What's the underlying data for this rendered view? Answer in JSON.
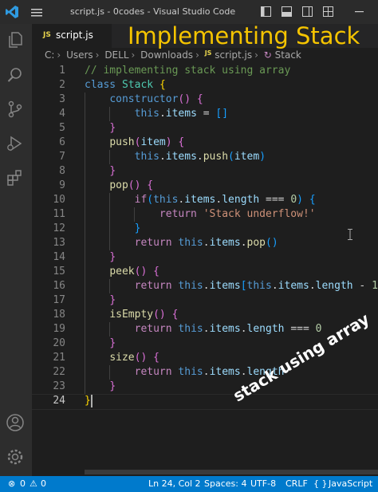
{
  "window": {
    "title": "script.js - 0codes - Visual Studio Code"
  },
  "tab": {
    "badge": "JS",
    "label": "script.js"
  },
  "overlay": {
    "title": "Implementing Stack",
    "caption": "stack using array"
  },
  "breadcrumb": {
    "segments": [
      "C:",
      "Users",
      "DELL",
      "Downloads"
    ],
    "file_badge": "JS",
    "file": "script.js",
    "symbol_icon": "↻",
    "symbol": "Stack"
  },
  "editor": {
    "current_line": 24,
    "lines": [
      {
        "n": "1",
        "tokens": [
          [
            "c",
            "// implementing stack using array"
          ]
        ]
      },
      {
        "n": "2",
        "tokens": [
          [
            "k",
            "class"
          ],
          [
            "o",
            " "
          ],
          [
            "t",
            "Stack"
          ],
          [
            "o",
            " "
          ],
          [
            "b1",
            "{"
          ]
        ]
      },
      {
        "n": "3",
        "tokens": [
          [
            "o",
            "    "
          ],
          [
            "k",
            "constructor"
          ],
          [
            "b2",
            "()"
          ],
          [
            "o",
            " "
          ],
          [
            "b2",
            "{"
          ]
        ]
      },
      {
        "n": "4",
        "tokens": [
          [
            "o",
            "        "
          ],
          [
            "k",
            "this"
          ],
          [
            "o",
            "."
          ],
          [
            "v",
            "items"
          ],
          [
            "o",
            " = "
          ],
          [
            "b3",
            "[]"
          ]
        ]
      },
      {
        "n": "5",
        "tokens": [
          [
            "o",
            "    "
          ],
          [
            "b2",
            "}"
          ]
        ]
      },
      {
        "n": "6",
        "tokens": [
          [
            "o",
            "    "
          ],
          [
            "f",
            "push"
          ],
          [
            "b2",
            "("
          ],
          [
            "v",
            "item"
          ],
          [
            "b2",
            ")"
          ],
          [
            "o",
            " "
          ],
          [
            "b2",
            "{"
          ]
        ]
      },
      {
        "n": "7",
        "tokens": [
          [
            "o",
            "        "
          ],
          [
            "k",
            "this"
          ],
          [
            "o",
            "."
          ],
          [
            "v",
            "items"
          ],
          [
            "o",
            "."
          ],
          [
            "f",
            "push"
          ],
          [
            "b3",
            "("
          ],
          [
            "v",
            "item"
          ],
          [
            "b3",
            ")"
          ]
        ]
      },
      {
        "n": "8",
        "tokens": [
          [
            "o",
            "    "
          ],
          [
            "b2",
            "}"
          ]
        ]
      },
      {
        "n": "9",
        "tokens": [
          [
            "o",
            "    "
          ],
          [
            "f",
            "pop"
          ],
          [
            "b2",
            "()"
          ],
          [
            "o",
            " "
          ],
          [
            "b2",
            "{"
          ]
        ]
      },
      {
        "n": "10",
        "tokens": [
          [
            "o",
            "        "
          ],
          [
            "k2",
            "if"
          ],
          [
            "b3",
            "("
          ],
          [
            "k",
            "this"
          ],
          [
            "o",
            "."
          ],
          [
            "v",
            "items"
          ],
          [
            "o",
            "."
          ],
          [
            "v",
            "length"
          ],
          [
            "o",
            " === "
          ],
          [
            "n",
            "0"
          ],
          [
            "b3",
            ")"
          ],
          [
            "o",
            " "
          ],
          [
            "b3",
            "{"
          ]
        ]
      },
      {
        "n": "11",
        "tokens": [
          [
            "o",
            "            "
          ],
          [
            "k2",
            "return"
          ],
          [
            "o",
            " "
          ],
          [
            "s",
            "'Stack underflow!'"
          ]
        ]
      },
      {
        "n": "12",
        "tokens": [
          [
            "o",
            "        "
          ],
          [
            "b3",
            "}"
          ]
        ]
      },
      {
        "n": "13",
        "tokens": [
          [
            "o",
            "        "
          ],
          [
            "k2",
            "return"
          ],
          [
            "o",
            " "
          ],
          [
            "k",
            "this"
          ],
          [
            "o",
            "."
          ],
          [
            "v",
            "items"
          ],
          [
            "o",
            "."
          ],
          [
            "f",
            "pop"
          ],
          [
            "b3",
            "()"
          ]
        ]
      },
      {
        "n": "14",
        "tokens": [
          [
            "o",
            "    "
          ],
          [
            "b2",
            "}"
          ]
        ]
      },
      {
        "n": "15",
        "tokens": [
          [
            "o",
            "    "
          ],
          [
            "f",
            "peek"
          ],
          [
            "b2",
            "()"
          ],
          [
            "o",
            " "
          ],
          [
            "b2",
            "{"
          ]
        ]
      },
      {
        "n": "16",
        "tokens": [
          [
            "o",
            "        "
          ],
          [
            "k2",
            "return"
          ],
          [
            "o",
            " "
          ],
          [
            "k",
            "this"
          ],
          [
            "o",
            "."
          ],
          [
            "v",
            "items"
          ],
          [
            "b3",
            "["
          ],
          [
            "k",
            "this"
          ],
          [
            "o",
            "."
          ],
          [
            "v",
            "items"
          ],
          [
            "o",
            "."
          ],
          [
            "v",
            "length"
          ],
          [
            "o",
            " - "
          ],
          [
            "n",
            "1"
          ],
          [
            "b3",
            "]"
          ]
        ]
      },
      {
        "n": "17",
        "tokens": [
          [
            "o",
            "    "
          ],
          [
            "b2",
            "}"
          ]
        ]
      },
      {
        "n": "18",
        "tokens": [
          [
            "o",
            "    "
          ],
          [
            "f",
            "isEmpty"
          ],
          [
            "b2",
            "()"
          ],
          [
            "o",
            " "
          ],
          [
            "b2",
            "{"
          ]
        ]
      },
      {
        "n": "19",
        "tokens": [
          [
            "o",
            "        "
          ],
          [
            "k2",
            "return"
          ],
          [
            "o",
            " "
          ],
          [
            "k",
            "this"
          ],
          [
            "o",
            "."
          ],
          [
            "v",
            "items"
          ],
          [
            "o",
            "."
          ],
          [
            "v",
            "length"
          ],
          [
            "o",
            " === "
          ],
          [
            "n",
            "0"
          ]
        ]
      },
      {
        "n": "20",
        "tokens": [
          [
            "o",
            "    "
          ],
          [
            "b2",
            "}"
          ]
        ]
      },
      {
        "n": "21",
        "tokens": [
          [
            "o",
            "    "
          ],
          [
            "f",
            "size"
          ],
          [
            "b2",
            "()"
          ],
          [
            "o",
            " "
          ],
          [
            "b2",
            "{"
          ]
        ]
      },
      {
        "n": "22",
        "tokens": [
          [
            "o",
            "        "
          ],
          [
            "k2",
            "return"
          ],
          [
            "o",
            " "
          ],
          [
            "k",
            "this"
          ],
          [
            "o",
            "."
          ],
          [
            "v",
            "items"
          ],
          [
            "o",
            "."
          ],
          [
            "v",
            "length"
          ]
        ]
      },
      {
        "n": "23",
        "tokens": [
          [
            "o",
            "    "
          ],
          [
            "b2",
            "}"
          ]
        ]
      },
      {
        "n": "24",
        "tokens": [
          [
            "b1",
            "}"
          ]
        ]
      }
    ]
  },
  "statusbar": {
    "errors": "0",
    "warnings": "0",
    "position": "Ln 24, Col 2",
    "spaces": "Spaces: 4",
    "encoding": "UTF-8",
    "eol": "CRLF",
    "language_icon": "{ }",
    "language": "JavaScript"
  },
  "colors": {
    "accent": "#007acc",
    "overlay_title": "#f5c400",
    "js_badge": "#e8d44d"
  },
  "icons": [
    "vscode-logo-icon",
    "menu-icon",
    "layout-sidebar-icon",
    "layout-panel-icon",
    "layout-secondary-icon",
    "layout-grid-icon",
    "explorer-icon",
    "search-icon",
    "source-control-icon",
    "run-debug-icon",
    "extensions-icon",
    "account-icon",
    "settings-gear-icon",
    "error-icon",
    "warning-icon"
  ]
}
